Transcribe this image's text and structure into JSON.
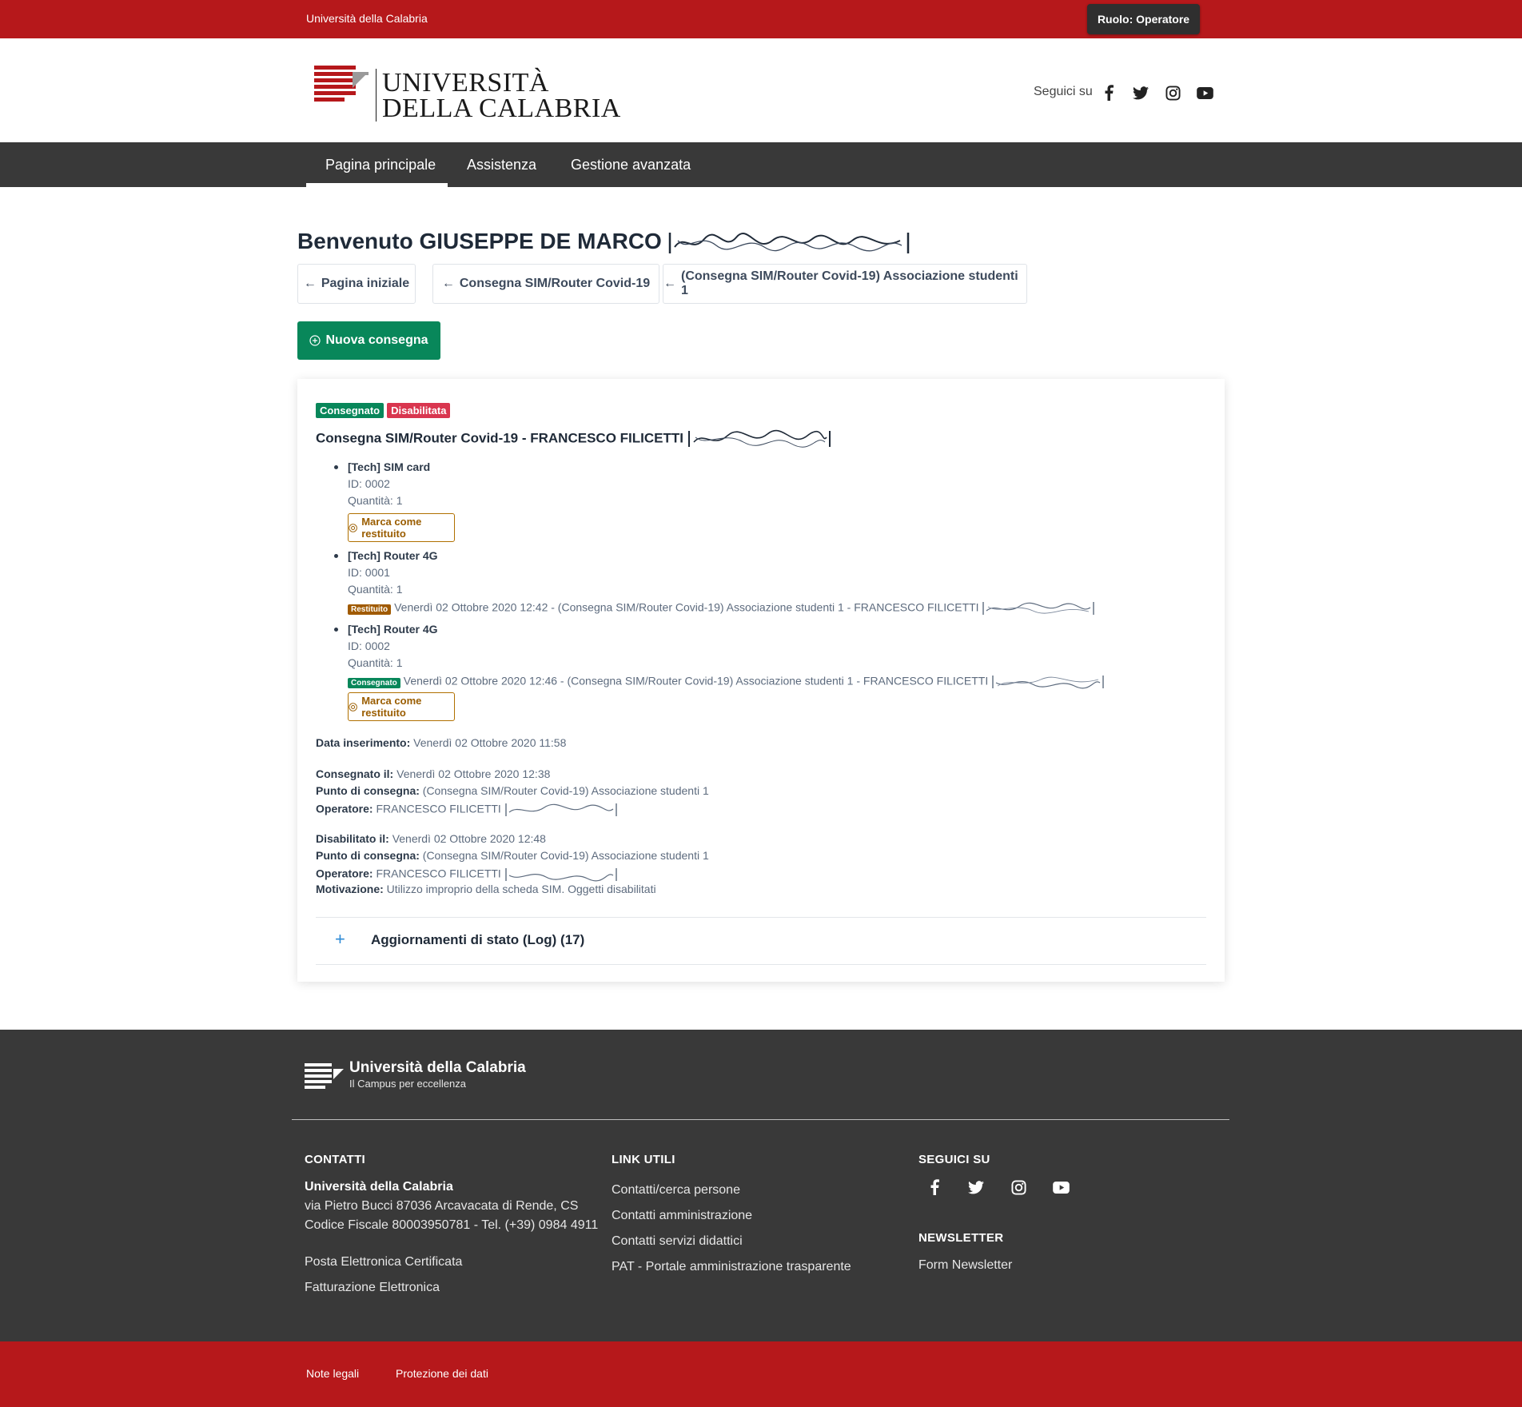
{
  "topbar": {
    "brand": "Università della Calabria",
    "role_button": "Ruolo: Operatore"
  },
  "header": {
    "logo_line1": "UNIVERSITÀ",
    "logo_line2": "DELLA CALABRIA",
    "social_label": "Seguici su",
    "social_icons": [
      "facebook-icon",
      "twitter-icon",
      "instagram-icon",
      "youtube-icon"
    ]
  },
  "nav": {
    "items": [
      "Pagina principale",
      "Assistenza",
      "Gestione avanzata"
    ],
    "active": "Pagina principale"
  },
  "main": {
    "welcome": "Benvenuto GIUSEPPE DE MARCO",
    "breadcrumbs": [
      "Pagina iniziale",
      "Consegna SIM/Router Covid-19",
      "(Consegna SIM/Router Covid-19) Associazione studenti 1"
    ],
    "new_button": "Nuova consegna"
  },
  "card": {
    "badges": {
      "consegnato": "Consegnato",
      "disabilitata": "Disabilitata"
    },
    "badge_colors": {
      "green": "#08875a",
      "red": "#d9364f",
      "orange": "#a05a00"
    },
    "title": "Consegna SIM/Router Covid-19 - FRANCESCO FILICETTI",
    "items": [
      {
        "title": "[Tech] SIM card",
        "id": "ID: 0002",
        "qty": "Quantità: 1",
        "button": "Marca come restituito"
      },
      {
        "title": "[Tech] Router 4G",
        "id": "ID: 0001",
        "qty": "Quantità: 1",
        "status_badge": "Restituito",
        "status_text": "Venerdì 02 Ottobre 2020 12:42 - (Consegna SIM/Router Covid-19) Associazione studenti 1 - FRANCESCO FILICETTI"
      },
      {
        "title": "[Tech] Router 4G",
        "id": "ID: 0002",
        "qty": "Quantità: 1",
        "status_badge": "Consegnato",
        "status_text": "Venerdì 02 Ottobre 2020 12:46 - (Consegna SIM/Router Covid-19) Associazione studenti 1 - FRANCESCO FILICETTI",
        "button": "Marca come restituito"
      }
    ],
    "data_inserimento_label": "Data inserimento:",
    "data_inserimento": "Venerdì 02 Ottobre 2020 11:58",
    "consegnato_il_label": "Consegnato il:",
    "consegnato_il": "Venerdì 02 Ottobre 2020 12:38",
    "punto_label": "Punto di consegna:",
    "punto_1": "(Consegna SIM/Router Covid-19) Associazione studenti 1",
    "operatore_label": "Operatore:",
    "operatore_1": "FRANCESCO FILICETTI",
    "disabilitato_il_label": "Disabilitato il:",
    "disabilitato_il": "Venerdì 02 Ottobre 2020 12:48",
    "punto_2": "(Consegna SIM/Router Covid-19) Associazione studenti 1",
    "operatore_2": "FRANCESCO FILICETTI",
    "motivazione_label": "Motivazione:",
    "motivazione": "Utilizzo improprio della scheda SIM. Oggetti disabilitati",
    "log_label": "Aggiornamenti di stato (Log) (17)"
  },
  "footer": {
    "brand_title": "Università della Calabria",
    "brand_subtitle": "Il Campus per eccellenza",
    "contatti_head": "CONTATTI",
    "contatti_name": "Università della Calabria",
    "contatti_addr": "via Pietro Bucci 87036 Arcavacata di Rende, CS",
    "contatti_cf": "Codice Fiscale 80003950781 - Tel. (+39) 0984 4911",
    "contatti_links": [
      "Posta Elettronica Certificata",
      "Fatturazione Elettronica"
    ],
    "link_head": "LINK UTILI",
    "links": [
      "Contatti/cerca persone",
      "Contatti amministrazione",
      "Contatti servizi didattici",
      "PAT - Portale amministrazione trasparente"
    ],
    "seguici_head": "SEGUICI SU",
    "newsletter_head": "NEWSLETTER",
    "newsletter_link": "Form Newsletter"
  },
  "bottombar": {
    "links": [
      "Note legali",
      "Protezione dei dati"
    ]
  }
}
